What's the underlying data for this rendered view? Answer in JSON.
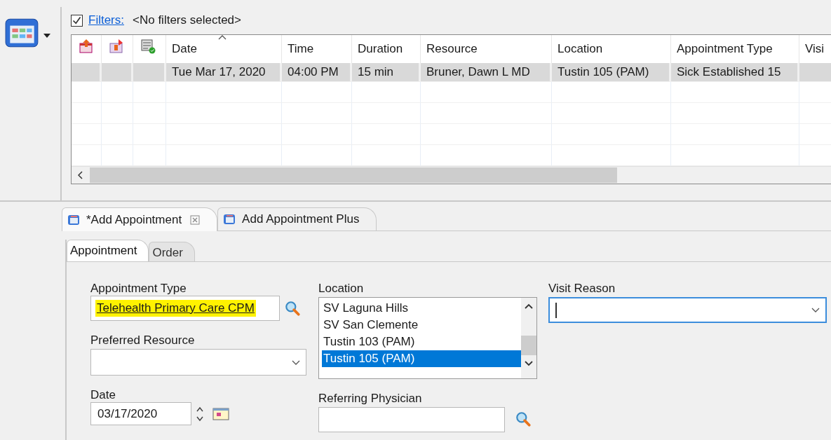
{
  "filters": {
    "checked": true,
    "link": "Filters:",
    "value": "<No filters selected>"
  },
  "table": {
    "columns": [
      {
        "kind": "icon"
      },
      {
        "kind": "icon"
      },
      {
        "kind": "icon"
      },
      {
        "kind": "text",
        "label": "Date",
        "sorted": true
      },
      {
        "kind": "text",
        "label": "Time",
        "sorted": false
      },
      {
        "kind": "text",
        "label": "Duration",
        "sorted": false
      },
      {
        "kind": "text",
        "label": "Resource",
        "sorted": false
      },
      {
        "kind": "text",
        "label": "Location",
        "sorted": false
      },
      {
        "kind": "text",
        "label": "Appointment Type",
        "sorted": false
      },
      {
        "kind": "text",
        "label": "Visi",
        "sorted": false
      }
    ],
    "rows": [
      {
        "selected": true,
        "cells": [
          "",
          "",
          "",
          "Tue Mar 17, 2020",
          "04:00 PM",
          "15 min",
          "Bruner, Dawn L MD",
          "Tustin 105 (PAM)",
          "Sick Established 15",
          ""
        ]
      }
    ]
  },
  "editor_tabs": [
    {
      "label": "*Add Appointment",
      "selected": true,
      "closable": true
    },
    {
      "label": "Add Appointment Plus",
      "selected": false,
      "closable": false
    }
  ],
  "sub_tabs": [
    {
      "label": "Appointment",
      "selected": true
    },
    {
      "label": "Order",
      "selected": false
    }
  ],
  "form": {
    "appointment_type": {
      "label": "Appointment Type",
      "value": "Telehealth Primary Care CPM",
      "highlighted": true
    },
    "preferred_resource": {
      "label": "Preferred Resource"
    },
    "date": {
      "label": "Date",
      "value": "03/17/2020"
    },
    "location": {
      "label": "Location",
      "options": [
        {
          "label": "SV Laguna Hills",
          "selected": false
        },
        {
          "label": "SV San Clemente",
          "selected": false
        },
        {
          "label": "Tustin 103 (PAM)",
          "selected": false
        },
        {
          "label": "Tustin 105 (PAM)",
          "selected": true
        }
      ]
    },
    "referring_physician": {
      "label": "Referring Physician"
    },
    "visit_reason": {
      "label": "Visit Reason",
      "focused": true
    }
  }
}
